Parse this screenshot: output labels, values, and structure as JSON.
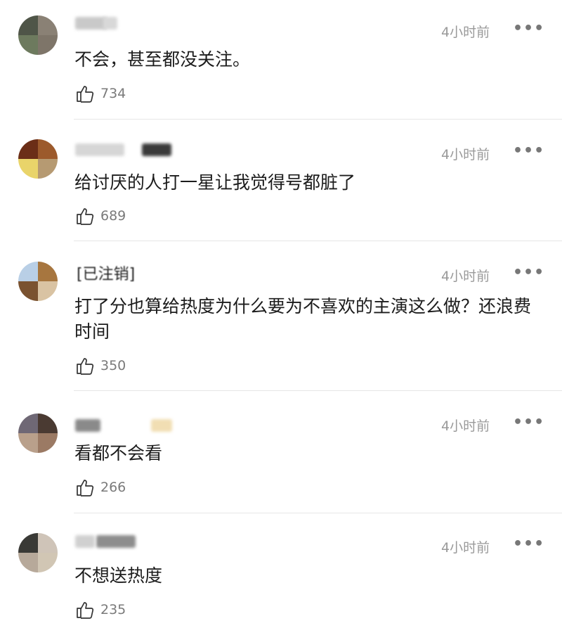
{
  "comments": [
    {
      "time": "4小时前",
      "text": "不会，甚至都没关注。",
      "likes": "734",
      "avatar_colors": [
        "#4f5548",
        "#8a8175",
        "#6d7a5e",
        "#7e7569"
      ],
      "name_colors": [
        "#c9c9c9",
        "#d8d8d8"
      ],
      "name_text": ""
    },
    {
      "time": "4小时前",
      "text": "给讨厌的人打一星让我觉得号都脏了",
      "likes": "689",
      "avatar_colors": [
        "#6b2e17",
        "#9c5a2c",
        "#e9d46a",
        "#b69a72"
      ],
      "name_colors": [
        "#d6d6d6",
        "#3a3a3a"
      ],
      "name_text": ""
    },
    {
      "time": "4小时前",
      "text": "打了分也算给热度为什么要为不喜欢的主演这么做？还浪费时间",
      "likes": "350",
      "avatar_colors": [
        "#b9cfe6",
        "#a7763f",
        "#7a5230",
        "#d9c3a3"
      ],
      "name_colors": [
        "#ffffff",
        "#202020"
      ],
      "name_text": "[已注销]"
    },
    {
      "time": "4小时前",
      "text": "看都不会看",
      "likes": "266",
      "avatar_colors": [
        "#6f6875",
        "#4a3a32",
        "#b9a08b",
        "#9b7a64"
      ],
      "name_colors": [
        "#8a8a8a",
        "#f1deb3"
      ],
      "name_text": ""
    },
    {
      "time": "4小时前",
      "text": "不想送热度",
      "likes": "235",
      "avatar_colors": [
        "#3a3a36",
        "#cfc4b8",
        "#b7a99a",
        "#d1c6b4"
      ],
      "name_colors": [
        "#8d8d8d",
        "#d0d0d0"
      ],
      "name_text": ""
    }
  ],
  "more_glyph": "•••"
}
